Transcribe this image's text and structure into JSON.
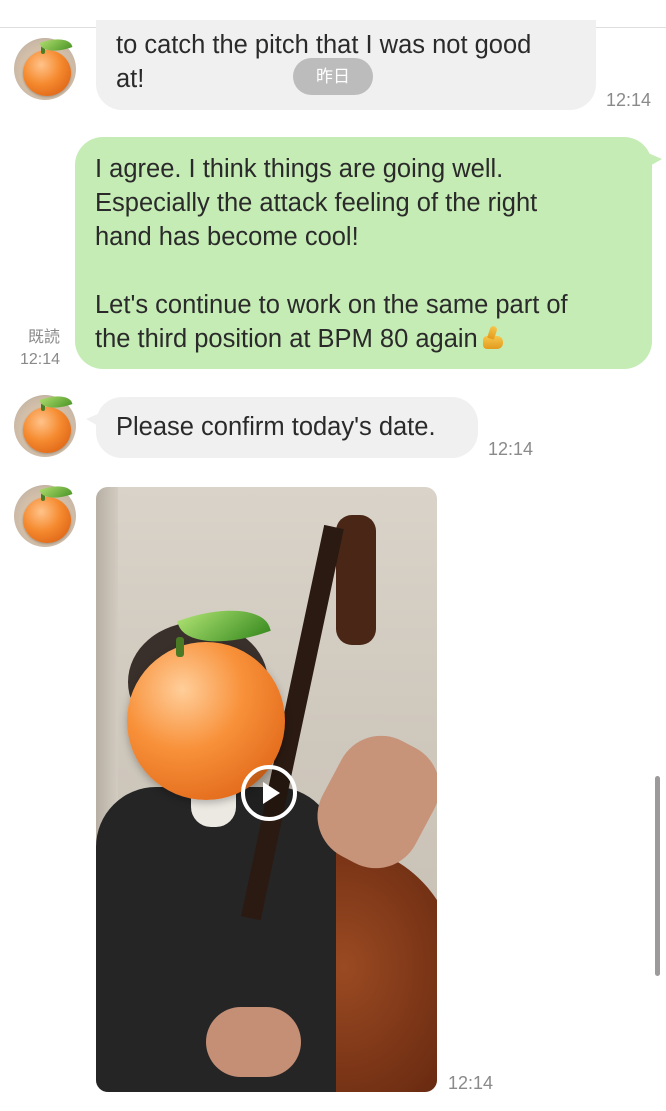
{
  "messages": [
    {
      "sender": "them",
      "lines": [
        "to catch the pitch that I was not good",
        "at!"
      ],
      "time": "12:14"
    },
    {
      "sender": "me",
      "lines": [
        "I agree. I think things are going well.",
        "Especially the attack feeling of the right",
        "hand has become cool!",
        "",
        "Let's continue to work on the same part of",
        "the third position at BPM 80 again"
      ],
      "emoji": "thumbs-up",
      "read_label": "既読",
      "time": "12:14"
    },
    {
      "sender": "them",
      "lines": [
        "Please confirm today's date."
      ],
      "time": "12:14"
    },
    {
      "sender": "them",
      "type": "video",
      "time": "12:14"
    }
  ],
  "date_divider": "昨日"
}
